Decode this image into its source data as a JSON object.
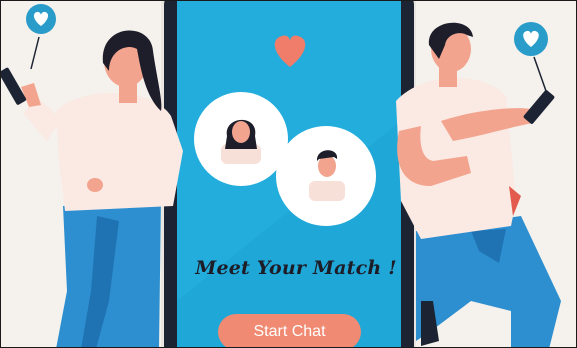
{
  "screen": {
    "headline": "Meet Your Match !",
    "cta_label": "Start Chat"
  },
  "icons": {
    "top_heart": "heart-icon",
    "left_bubble": "heart-bubble-icon",
    "right_bubble": "heart-bubble-icon",
    "woman_avatar": "woman-avatar-icon",
    "man_avatar": "man-avatar-icon"
  },
  "colors": {
    "phone_screen": "#1fa7d8",
    "accent_coral": "#f08a72",
    "heart_coral": "#f07c6a",
    "bubble_blue": "#2a9cc9",
    "jeans_blue": "#2d8fd0",
    "phone_frame": "#1c2433",
    "background": "#f5f1ec"
  }
}
